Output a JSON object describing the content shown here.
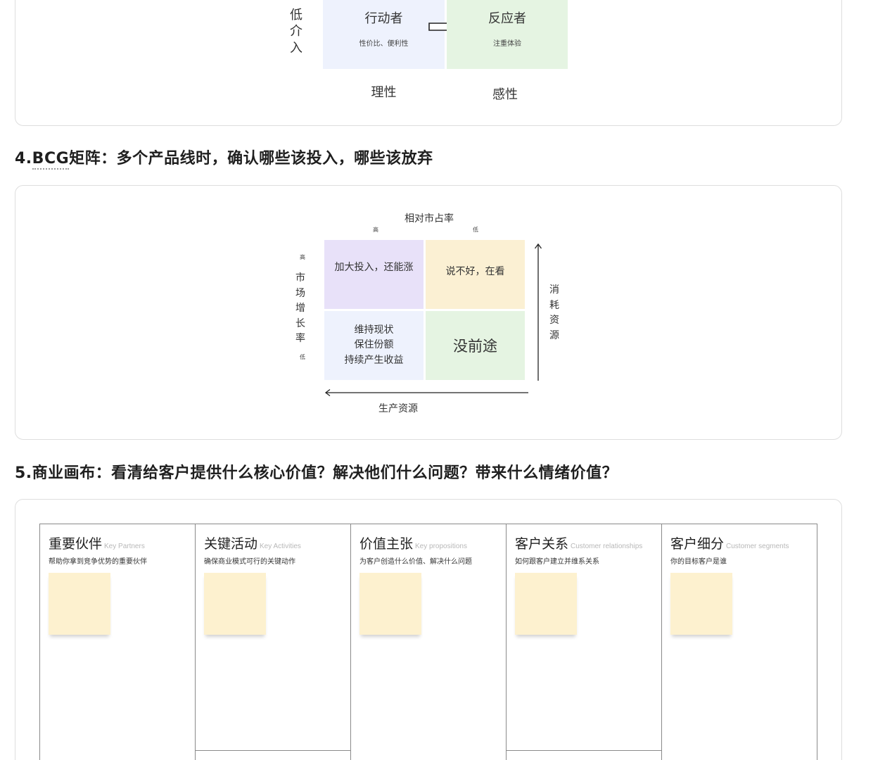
{
  "matrix_top": {
    "left_axis": [
      "低",
      "介",
      "入"
    ],
    "cells": [
      {
        "title": "行动者",
        "desc": "性价比、便利性",
        "color": "#eef2fd"
      },
      {
        "title": "反应者",
        "desc": "注重体验",
        "color": "#e5f4e2"
      }
    ],
    "bottom_labels": [
      "理性",
      "感性"
    ],
    "arrow_icon": "right-arrow-icon"
  },
  "section4": {
    "number": "4.",
    "term": "BCG",
    "title_rest": "矩阵：多个产品线时，确认哪些该投入，哪些该放弃",
    "bcg": {
      "top_axis_label": "相对市占率",
      "top_high": "高",
      "top_low": "低",
      "left_high": "高",
      "left_axis": [
        "市",
        "场",
        "增",
        "长",
        "率"
      ],
      "left_low": "低",
      "right_axis": [
        "消",
        "耗",
        "资",
        "源"
      ],
      "bottom_axis_label": "生产资源",
      "cells": [
        {
          "lines": [
            "加大投入，还能涨"
          ],
          "color": "#e8e1f9"
        },
        {
          "lines": [
            "说不好，在看"
          ],
          "color": "#fbf0d3"
        },
        {
          "lines": [
            "维持现状",
            "保住份额",
            "持续产生收益"
          ],
          "color": "#eef2fd"
        },
        {
          "lines": [
            "没前途"
          ],
          "color": "#e5f4e2"
        }
      ]
    }
  },
  "section5": {
    "title": "5.商业画布：看清给客户提供什么核心价值？解决他们什么问题？带来什么情绪价值？",
    "columns": [
      {
        "title": "重要伙伴",
        "en": "Key Partners",
        "desc": "帮助你拿到竞争优势的重要伙伴"
      },
      {
        "title": "关键活动",
        "en": "Key Activities",
        "desc": "确保商业模式可行的关键动作"
      },
      {
        "title": "价值主张",
        "en": "Key propositions",
        "desc": "为客户创造什么价值、解决什么问题"
      },
      {
        "title": "客户关系",
        "en": "Customer relationships",
        "desc": "如何跟客户建立并维系关系"
      },
      {
        "title": "客户细分",
        "en": "Customer segments",
        "desc": "你的目标客户是谁"
      }
    ]
  }
}
